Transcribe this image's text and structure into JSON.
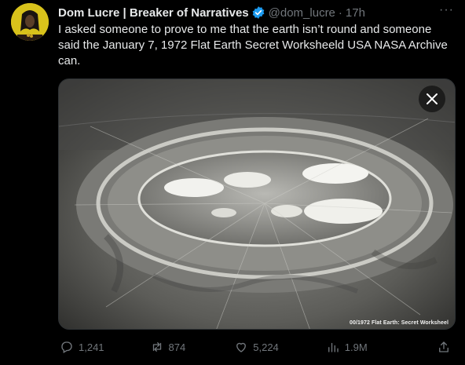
{
  "tweet": {
    "author_name": "Dom Lucre | Breaker of Narratives",
    "handle": "@dom_lucre",
    "separator": "·",
    "time": "17h",
    "more_label": "···",
    "text": "I asked someone to prove to me that the earth isn’t round and someone said the January 7, 1972 Flat Earth Secret Worksheeld USA NASA Archive can.",
    "media": {
      "caption": "00/1972 Flat Earth: Secret Worksheel",
      "close_label": "×"
    },
    "actions": {
      "replies": "1,241",
      "retweets": "874",
      "likes": "5,224",
      "views": "1.9M"
    }
  },
  "colors": {
    "background": "#000000",
    "text": "#e7e9ea",
    "secondary": "#71767b",
    "verified": "#1d9bf0",
    "avatar_bg": "#d8c21b"
  },
  "icons": [
    "avatar-image",
    "verified-badge-icon",
    "more-icon",
    "close-icon",
    "reply-icon",
    "retweet-icon",
    "like-icon",
    "views-icon",
    "share-icon"
  ]
}
